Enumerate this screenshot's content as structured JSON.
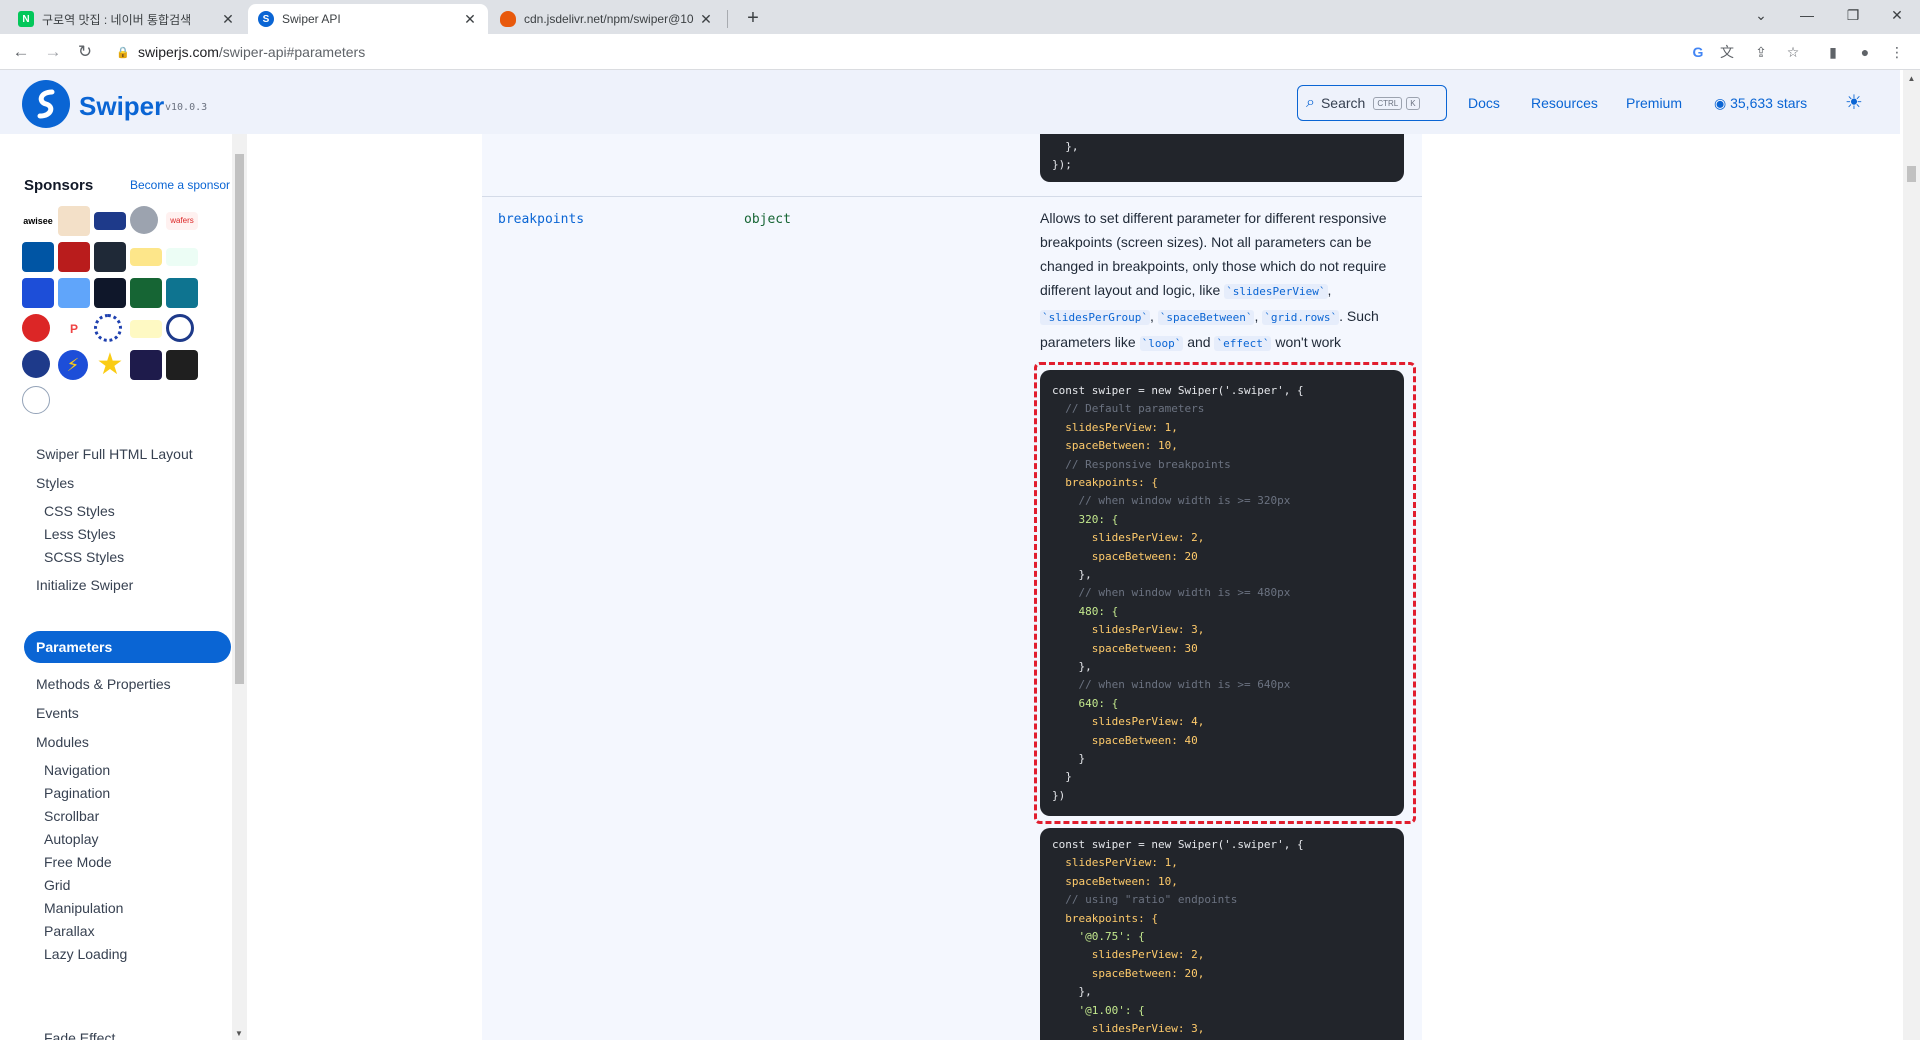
{
  "browser": {
    "tabs": [
      {
        "title": "구로역 맛집 : 네이버 통합검색",
        "favicon": "N"
      },
      {
        "title": "Swiper API",
        "favicon": "S"
      },
      {
        "title": "cdn.jsdelivr.net/npm/swiper@10",
        "favicon": "shield"
      }
    ],
    "url_host": "swiperjs.com",
    "url_path": "/swiper-api#parameters"
  },
  "header": {
    "brand": "Swiper",
    "version": "v10.0.3",
    "search_label": "Search",
    "search_kbd_ctrl": "CTRL",
    "search_kbd_k": "K",
    "nav": [
      "Docs",
      "Resources",
      "Premium"
    ],
    "stars": "35,633 stars",
    "accent": "#0a65d4"
  },
  "sidebar": {
    "sponsors_title": "Sponsors",
    "become_sponsor": "Become a sponsor",
    "items": [
      {
        "label": "Swiper Full HTML Layout",
        "level": 1
      },
      {
        "label": "Styles",
        "level": 1
      },
      {
        "label": "CSS Styles",
        "level": 2
      },
      {
        "label": "Less Styles",
        "level": 2
      },
      {
        "label": "SCSS Styles",
        "level": 2
      },
      {
        "label": "Initialize Swiper",
        "level": 1
      },
      {
        "label": "Parameters",
        "level": 1,
        "active": true
      },
      {
        "label": "Methods & Properties",
        "level": 1
      },
      {
        "label": "Events",
        "level": 1
      },
      {
        "label": "Modules",
        "level": 1
      },
      {
        "label": "Navigation",
        "level": 2
      },
      {
        "label": "Pagination",
        "level": 2
      },
      {
        "label": "Scrollbar",
        "level": 2
      },
      {
        "label": "Autoplay",
        "level": 2
      },
      {
        "label": "Free Mode",
        "level": 2
      },
      {
        "label": "Grid",
        "level": 2
      },
      {
        "label": "Manipulation",
        "level": 2
      },
      {
        "label": "Parallax",
        "level": 2
      },
      {
        "label": "Lazy Loading",
        "level": 2
      },
      {
        "label": "Fade Effect",
        "level": 2
      }
    ]
  },
  "param": {
    "name": "breakpoints",
    "type": "object",
    "desc_1": "Allows to set different parameter for different responsive breakpoints (screen sizes). Not all parameters can be changed in breakpoints, only those which do not require different layout and logic, like ",
    "code_1": "`slidesPerView`",
    "sep_1": ", ",
    "code_2": "`slidesPerGroup`",
    "sep_2": ", ",
    "code_3": "`spaceBetween`",
    "sep_3": ", ",
    "code_4": "`grid.rows`",
    "desc_2": ". Such parameters like ",
    "code_5": "`loop`",
    "desc_3": " and ",
    "code_6": "`effect`",
    "desc_4": " won't work"
  },
  "prev_code_tail": [
    "  },",
    "});"
  ],
  "code_block_1": [
    "const swiper = new Swiper('.swiper', {",
    "  // Default parameters",
    "  slidesPerView: 1,",
    "  spaceBetween: 10,",
    "  // Responsive breakpoints",
    "  breakpoints: {",
    "    // when window width is >= 320px",
    "    320: {",
    "      slidesPerView: 2,",
    "      spaceBetween: 20",
    "    },",
    "    // when window width is >= 480px",
    "    480: {",
    "      slidesPerView: 3,",
    "      spaceBetween: 30",
    "    },",
    "    // when window width is >= 640px",
    "    640: {",
    "      slidesPerView: 4,",
    "      spaceBetween: 40",
    "    }",
    "  }",
    "})"
  ],
  "code_block_2": [
    "const swiper = new Swiper('.swiper', {",
    "  slidesPerView: 1,",
    "  spaceBetween: 10,",
    "  // using \"ratio\" endpoints",
    "  breakpoints: {",
    "    '@0.75': {",
    "      slidesPerView: 2,",
    "      spaceBetween: 20,",
    "    },",
    "    '@1.00': {",
    "      slidesPerView: 3,"
  ]
}
